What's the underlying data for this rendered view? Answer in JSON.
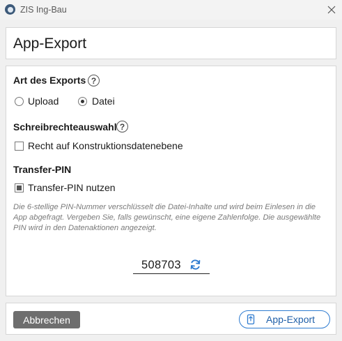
{
  "window": {
    "title": "ZIS Ing-Bau",
    "close_icon": "close-icon"
  },
  "header": {
    "title": "App-Export"
  },
  "export_type": {
    "label": "Art des Exports",
    "help": "?",
    "options": [
      {
        "label": "Upload",
        "selected": false
      },
      {
        "label": "Datei",
        "selected": true
      }
    ]
  },
  "write_permission": {
    "label": "Schreibrechteauswahl",
    "help": "?",
    "checkbox_label": "Recht auf Konstruktionsdatenebene",
    "checked": false
  },
  "transfer_pin": {
    "label": "Transfer-PIN",
    "checkbox_label": "Transfer-PIN nutzen",
    "checked": true,
    "description": "Die 6-stellige PIN-Nummer verschlüsselt die Datei-Inhalte und wird beim Einlesen in die App abgefragt. Vergeben Sie, falls gewünscht, eine eigene Zahlenfolge. Die ausgewählte PIN wird in den Datenaktionen angezeigt.",
    "pin_value": "508703",
    "refresh_icon": "refresh-icon"
  },
  "footer": {
    "cancel_label": "Abbrechen",
    "export_label": "App-Export",
    "export_icon": "phone-export-icon"
  },
  "colors": {
    "accent": "#2e7bd0",
    "cancel_bg": "#6e6e6e"
  }
}
